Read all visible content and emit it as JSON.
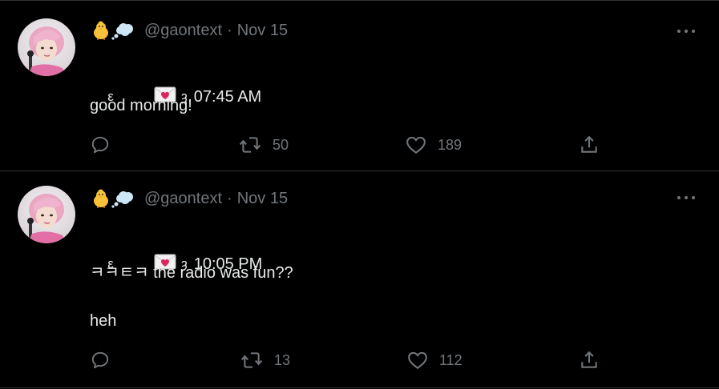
{
  "tweets": [
    {
      "handle": "@gaontext",
      "separator": "·",
      "date": "Nov 15",
      "kiss_left": "ε",
      "kiss_right": "ȝ",
      "time": "07:45 AM",
      "body": "good morning!",
      "retweets": "50",
      "likes": "189"
    },
    {
      "handle": "@gaontext",
      "separator": "·",
      "date": "Nov 15",
      "kiss_left": "ε",
      "kiss_right": "ȝ",
      "time": "10:05 PM",
      "body_line1": "ㅋㅋㅌㅋ the radio was fun??",
      "body_line2": "heh",
      "retweets": "13",
      "likes": "112"
    }
  ],
  "colors": {
    "background": "#000000",
    "text": "#e7e9ea",
    "secondary": "#71767b",
    "divider": "#2f3336",
    "envelope_heart": "#e0245e"
  },
  "icons": [
    "chick-emoji-icon",
    "thought-balloon-icon",
    "envelope-heart-icon",
    "reply-icon",
    "retweet-icon",
    "like-icon",
    "share-icon",
    "more-icon",
    "avatar"
  ]
}
